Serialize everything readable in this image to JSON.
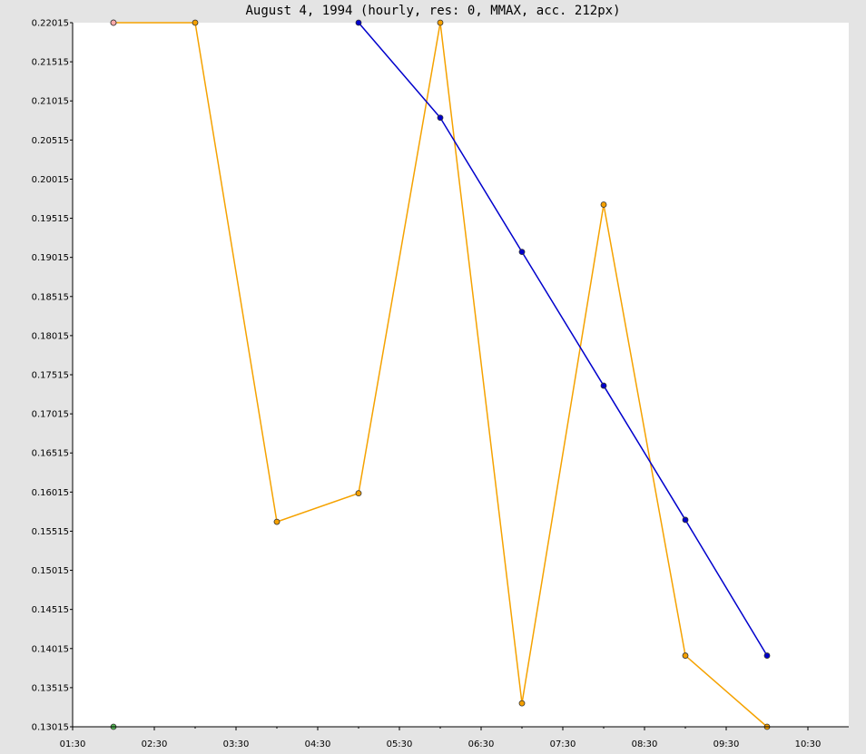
{
  "chart_data": {
    "type": "line",
    "title": "August 4, 1994 (hourly, res: 0, MMAX, acc. 212px)",
    "xlabel": "",
    "ylabel": "",
    "x_tick_labels": [
      "01:30",
      "02:30",
      "03:30",
      "04:30",
      "05:30",
      "06:30",
      "07:30",
      "08:30",
      "09:30",
      "10:30"
    ],
    "x_tick_hours": [
      1.5,
      2.5,
      3.5,
      4.5,
      5.5,
      6.5,
      7.5,
      8.5,
      9.5,
      10.5
    ],
    "xlim": [
      1.5,
      11.0
    ],
    "y_tick_labels": [
      "0.13015",
      "0.13515",
      "0.14015",
      "0.14515",
      "0.15015",
      "0.15515",
      "0.16015",
      "0.16515",
      "0.17015",
      "0.17515",
      "0.18015",
      "0.18515",
      "0.19015",
      "0.19515",
      "0.20015",
      "0.20515",
      "0.21015",
      "0.21515",
      "0.22015"
    ],
    "ylim": [
      0.13015,
      0.22015
    ],
    "grid": false,
    "legend": "none",
    "series": [
      {
        "color": "#f5a200",
        "marker_fill": "#f5a000",
        "x": [
          2,
          3,
          4,
          5,
          6,
          7,
          8,
          9,
          10
        ],
        "y": [
          0.22015,
          0.22015,
          0.15635,
          0.16,
          0.22015,
          0.13315,
          0.1969,
          0.13925,
          0.13015
        ]
      },
      {
        "color": "#0000cc",
        "marker_fill": "#0000cc",
        "x": [
          5,
          6,
          7,
          8,
          9,
          10
        ],
        "y": [
          0.22015,
          0.208,
          0.19085,
          0.17375,
          0.1566,
          0.13925
        ]
      }
    ],
    "extra_points": [
      {
        "x": 2,
        "y": 0.22015,
        "fill": "#ffaaaa"
      },
      {
        "x": 2,
        "y": 0.13015,
        "fill": "#55bb55"
      }
    ]
  }
}
